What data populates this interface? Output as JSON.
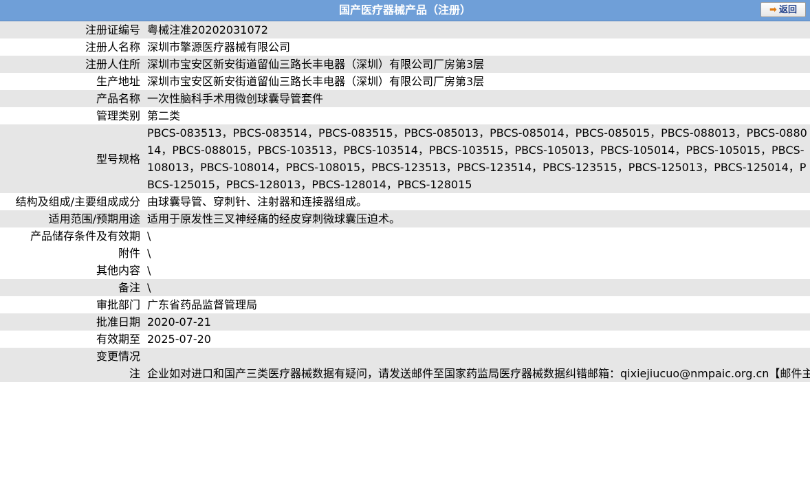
{
  "header": {
    "title": "国产医疗器械产品（注册）",
    "back_label": "返回",
    "back_icon": "arrow-right-icon"
  },
  "rows": [
    {
      "label": "注册证编号",
      "value": "粤械注准20202031072"
    },
    {
      "label": "注册人名称",
      "value": "深圳市擎源医疗器械有限公司"
    },
    {
      "label": "注册人住所",
      "value": "深圳市宝安区新安街道留仙三路长丰电器（深圳）有限公司厂房第3层"
    },
    {
      "label": "生产地址",
      "value": "深圳市宝安区新安街道留仙三路长丰电器（深圳）有限公司厂房第3层"
    },
    {
      "label": "产品名称",
      "value": "一次性脑科手术用微创球囊导管套件"
    },
    {
      "label": "管理类别",
      "value": "第二类"
    },
    {
      "label": "型号规格",
      "value": "PBCS-083513，PBCS-083514，PBCS-083515，PBCS-085013，PBCS-085014，PBCS-085015，PBCS-088013，PBCS-088014，PBCS-088015，PBCS-103513，PBCS-103514，PBCS-103515，PBCS-105013，PBCS-105014，PBCS-105015，PBCS-108013，PBCS-108014，PBCS-108015，PBCS-123513，PBCS-123514，PBCS-123515，PBCS-125013，PBCS-125014，PBCS-125015，PBCS-128013，PBCS-128014，PBCS-128015"
    },
    {
      "label": "结构及组成/主要组成成分",
      "value": "由球囊导管、穿刺针、注射器和连接器组成。"
    },
    {
      "label": "适用范围/预期用途",
      "value": "适用于原发性三叉神经痛的经皮穿刺微球囊压迫术。"
    },
    {
      "label": "产品储存条件及有效期",
      "value": "\\"
    },
    {
      "label": "附件",
      "value": "\\"
    },
    {
      "label": "其他内容",
      "value": "\\"
    },
    {
      "label": "备注",
      "value": "\\"
    },
    {
      "label": "审批部门",
      "value": "广东省药品监督管理局"
    },
    {
      "label": "批准日期",
      "value": "2020-07-21"
    },
    {
      "label": "有效期至",
      "value": "2025-07-20"
    },
    {
      "label": "变更情况",
      "value": ""
    }
  ],
  "note": {
    "label": "注",
    "text": "企业如对进口和国产三类医疗器械数据有疑问，请发送邮件至国家药监局医疗器械数据纠错邮箱：qixiejiucuo@nmpaic.org.cn【邮件主题请注明“医疗器械数据问题”，邮件正文中请准确填写以下全部信息：1.医疗器械注册证号/备案号；2.类型（注册、变更、延续等）；3.问题描述（500字以内）；4.企业名称（全称）；5.统一社会信用代码；6.联系人姓名；7.联系电话（手机和座机）；8.联系邮箱】，或致电国家药监局医疗器械数据纠错电话010-88331514（此电话为我局医疗器械数据纠错联系电话，并非相应产品/企业业务咨询电话）。企业如对国产一类和二类医疗器械数据有疑问，请咨询国家局信息中心，电话010-88332877，88331520（工作日），也可通过发邮件与我们联系：邮件地址yaopinshuju@nmpaic.org.cn，邮件主题请注明“国产医疗器械产品（注册）-数据（注册证号/备案号）数据问题”。国产一类和二类医疗器械数据来源于省局，由省局通过数据共享平台进行纠错和维护。"
  }
}
